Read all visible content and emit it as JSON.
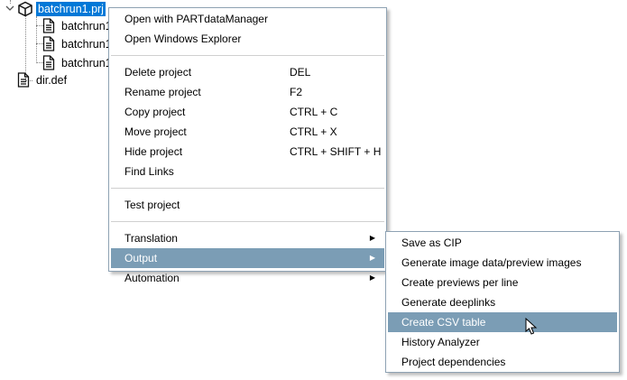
{
  "tree": {
    "root": {
      "label": "batchrun1.prj",
      "icon": "cube-icon"
    },
    "children": [
      {
        "label": "batchrun1"
      },
      {
        "label": "batchrun1"
      },
      {
        "label": "batchrun1"
      }
    ],
    "sibling": {
      "label": "dir.def"
    }
  },
  "context_menu": {
    "groups": [
      [
        {
          "label": "Open with PARTdataManager"
        },
        {
          "label": "Open Windows Explorer"
        }
      ],
      [
        {
          "label": "Delete project",
          "shortcut": "DEL"
        },
        {
          "label": "Rename project",
          "shortcut": "F2"
        },
        {
          "label": "Copy project",
          "shortcut": "CTRL + C"
        },
        {
          "label": "Move project",
          "shortcut": "CTRL + X"
        },
        {
          "label": "Hide project",
          "shortcut": "CTRL + SHIFT + H"
        },
        {
          "label": "Find Links"
        }
      ],
      [
        {
          "label": "Test project"
        }
      ],
      [
        {
          "label": "Translation",
          "submenu": true
        },
        {
          "label": "Output",
          "submenu": true,
          "highlighted": true
        },
        {
          "label": "Automation",
          "submenu": true
        }
      ]
    ]
  },
  "submenu": {
    "items": [
      {
        "label": "Save as CIP"
      },
      {
        "label": "Generate image data/preview images"
      },
      {
        "label": "Create previews per line"
      },
      {
        "label": "Generate deeplinks"
      },
      {
        "label": "Create CSV table",
        "highlighted": true
      },
      {
        "label": "History Analyzer"
      },
      {
        "label": "Project dependencies"
      }
    ]
  },
  "colors": {
    "highlight": "#7b9db5",
    "selection": "#0078d7"
  }
}
